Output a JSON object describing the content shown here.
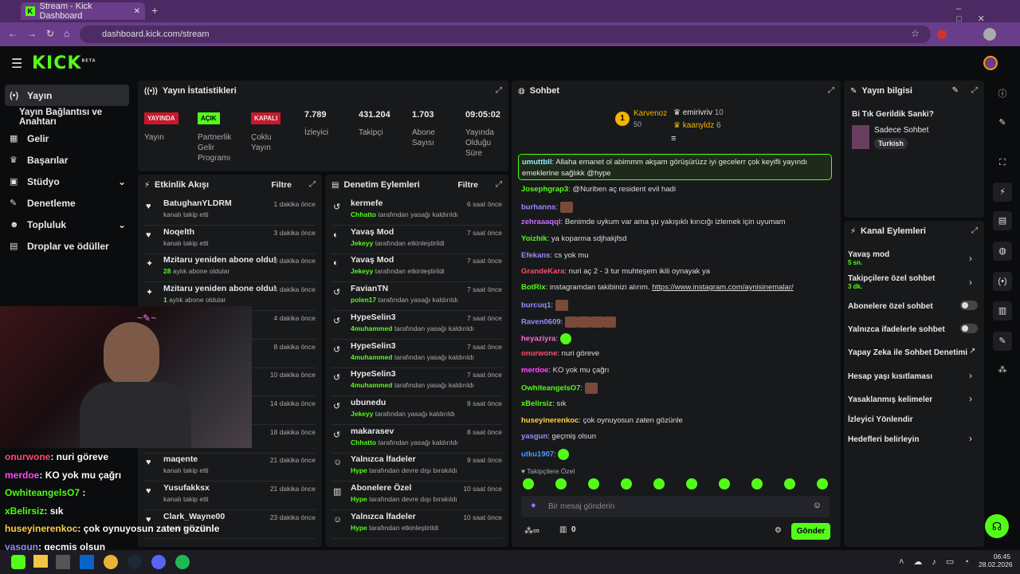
{
  "browser": {
    "tab_title": "Stream - Kick Dashboard",
    "url": "dashboard.kick.com/stream"
  },
  "header": {
    "logo": "KICK",
    "logo_beta": "BETA"
  },
  "sidebar": {
    "items": [
      {
        "label": "Yayın",
        "icon": "broadcast-icon"
      },
      {
        "label": "Yayın Bağlantısı ve Anahtarı",
        "icon": ""
      },
      {
        "label": "Gelir",
        "icon": "revenue-icon"
      },
      {
        "label": "Başarılar",
        "icon": "trophy-icon"
      },
      {
        "label": "Stüdyo",
        "icon": "studio-icon"
      },
      {
        "label": "Denetleme",
        "icon": "wrench-icon"
      },
      {
        "label": "Topluluk",
        "icon": "community-icon"
      },
      {
        "label": "Droplar ve ödüller",
        "icon": "gift-icon"
      }
    ]
  },
  "stats": {
    "title": "Yayın İstatistikleri",
    "live": {
      "badge": "YAYINDA",
      "label": "Yayın"
    },
    "partner": {
      "badge": "AÇIK",
      "label": "Partnerlik Gelir Programı"
    },
    "multi": {
      "badge": "KAPALI",
      "label": "Çoklu Yayın"
    },
    "viewers": {
      "value": "7.789",
      "label": "İzleyici"
    },
    "followers": {
      "value": "431.204",
      "label": "Takipçi"
    },
    "subs": {
      "value": "1.703",
      "label": "Abone Sayısı"
    },
    "uptime": {
      "value": "09:05:02",
      "label": "Yayında Olduğu Süre"
    }
  },
  "activity": {
    "title": "Etkinlik Akışı",
    "filter": "Filtre",
    "items": [
      {
        "name": "BatughanYLDRM",
        "sub": "kanalı takip etti",
        "time": "1 dakika önce"
      },
      {
        "name": "Noqelth",
        "sub": "kanalı takip etti",
        "time": "3 dakika önce"
      },
      {
        "name": "Mzitaru yeniden abone oldu!",
        "subb": "28",
        "sub": "aylık abone oldular",
        "time": "3 dakika önce"
      },
      {
        "name": "Mzitaru yeniden abone oldu!",
        "subb": "1",
        "sub": "aylık abone oldular",
        "time": "4 dakika önce"
      },
      {
        "time": "4 dakika önce"
      },
      {
        "time": "8 dakika önce"
      },
      {
        "time": "10 dakika önce"
      },
      {
        "time": "14 dakika önce"
      },
      {
        "time": "18 dakika önce"
      },
      {
        "name": "maqente",
        "sub": "kanalı takip etti",
        "time": "21 dakika önce"
      },
      {
        "name": "Yusufakksx",
        "sub": "kanalı takip etti",
        "time": "21 dakika önce"
      },
      {
        "name": "Clark_Wayne00",
        "sub": "kanalı takip etti",
        "time": "23 dakika önce"
      }
    ]
  },
  "moderation": {
    "title": "Denetim Eylemleri",
    "filter": "Filtre",
    "items": [
      {
        "name": "kermefe",
        "by": "Chhatto",
        "sub": "tarafından yasağı kaldırıldı",
        "time": "6 saat önce"
      },
      {
        "name": "Yavaş Mod",
        "by": "Jekeyy",
        "sub": "tarafından etkinleştirildi",
        "time": "7 saat önce"
      },
      {
        "name": "Yavaş Mod",
        "by": "Jekeyy",
        "sub": "tarafından etkinleştirildi",
        "time": "7 saat önce"
      },
      {
        "name": "FavianTN",
        "by": "polen17",
        "sub": "tarafından yasağı kaldırıldı",
        "time": "7 saat önce"
      },
      {
        "name": "HypeSelin3",
        "by": "4muhammed",
        "sub": "tarafından yasağı kaldırıldı",
        "time": "7 saat önce"
      },
      {
        "name": "HypeSelin3",
        "by": "4muhammed",
        "sub": "tarafından yasağı kaldırıldı",
        "time": "7 saat önce"
      },
      {
        "name": "HypeSelin3",
        "by": "4muhammed",
        "sub": "tarafından yasağı kaldırıldı",
        "time": "7 saat önce"
      },
      {
        "name": "ubunedu",
        "by": "Jekeyy",
        "sub": "tarafından yasağı kaldırıldı",
        "time": "8 saat önce"
      },
      {
        "name": "makarasev",
        "by": "Chhatto",
        "sub": "tarafından yasağı kaldırıldı",
        "time": "8 saat önce"
      },
      {
        "name": "Yalnızca İfadeler",
        "by": "Hype",
        "sub": "tarafından devre dışı bırakıldı",
        "time": "9 saat önce"
      },
      {
        "name": "Abonelere Özel",
        "by": "Hype",
        "sub": "tarafından devre dışı bırakıldı",
        "time": "10 saat önce"
      },
      {
        "name": "Yalnızca İfadeler",
        "by": "Hype",
        "sub": "tarafından etkinleştirildi",
        "time": "10 saat önce"
      }
    ]
  },
  "chat": {
    "title": "Sohbet",
    "top": [
      {
        "rank": "1",
        "name": "Karvenoz",
        "pts": "50"
      },
      {
        "name": "emirivriv",
        "pts": "10"
      },
      {
        "name": "kaanyldz",
        "pts": "6"
      }
    ],
    "pinned": {
      "user": "umuttbll",
      "text": "Allaha emanet ol abimmm akşam görüşürüzz iyi gecelerr çok keyifli yayındı emeklerine sağlıkk @hype"
    },
    "messages": [
      {
        "user": "Josephgrap3",
        "color": "#53fc18",
        "text": "@Nuriben aç resident evil hadi"
      },
      {
        "user": "burhanns",
        "color": "#9b8cff",
        "text": ""
      },
      {
        "user": "zehraaaqql",
        "color": "#c86bff",
        "text": "Benimde uykum var ama şu yakışıklı kırıcığı izlemek için uyumam"
      },
      {
        "user": "Yoizhik",
        "color": "#53fc18",
        "text": "ya koparma sdjhakjfsd"
      },
      {
        "user": "Efekans",
        "color": "#9b8cff",
        "text": "cs yok mu"
      },
      {
        "user": "GrandeKara",
        "color": "#ff4b6e",
        "text": "nuri aç 2 - 3 tur muhteşem ikili oynayak ya"
      },
      {
        "user": "BotRix",
        "color": "#53fc18",
        "text": "instagramdan takibinizi alırım.",
        "link": "https://www.instagram.com/aynisinemalar/"
      },
      {
        "user": "burcuq1",
        "color": "#9b8cff",
        "text": ""
      },
      {
        "user": "Raven0609",
        "color": "#9b8cff",
        "text": ""
      },
      {
        "user": "heyaziyra",
        "color": "#ff6bd6",
        "text": ""
      },
      {
        "user": "onurwone",
        "color": "#ff4b6e",
        "text": "nuri göreve"
      },
      {
        "user": "merdoe",
        "color": "#ff4bff",
        "text": "KO yok mu çağrı"
      },
      {
        "user": "OwhiteangelsO7",
        "color": "#53fc18",
        "text": ""
      },
      {
        "user": "xBelirsiz",
        "color": "#53fc18",
        "text": "sık"
      },
      {
        "user": "huseyinerenkoc",
        "color": "#ffcf4b",
        "text": "çok oynuyosun zaten gözünle"
      },
      {
        "user": "yasgun",
        "color": "#9b8cff",
        "text": "geçmiş olsun"
      },
      {
        "user": "utku1907",
        "color": "#4b9bff",
        "text": ""
      }
    ],
    "followers_label": "Takipçilere Özel",
    "placeholder": "Bir mesaj gönderin",
    "count": "0",
    "send": "Gönder"
  },
  "info": {
    "title": "Yayın bilgisi",
    "stream_title": "Bi Tık Gerildik Sanki?",
    "category": "Sadece Sohbet",
    "tag": "Turkish"
  },
  "actions": {
    "title": "Kanal Eylemleri",
    "items": [
      {
        "label": "Yavaş mod",
        "sub": "5 sn."
      },
      {
        "label": "Takipçilere özel sohbet",
        "sub": "3 dk."
      },
      {
        "label": "Abonelere özel sohbet"
      },
      {
        "label": "Yalnızca ifadelerle sohbet"
      },
      {
        "label": "Yapay Zeka ile Sohbet Denetimi"
      },
      {
        "label": "Hesap yaşı kısıtlaması"
      },
      {
        "label": "Yasaklanmış kelimeler"
      },
      {
        "label": "İzleyici Yönlendir"
      },
      {
        "label": "Hedefleri belirleyin"
      }
    ]
  },
  "overlay_chat": [
    {
      "user": "onurwone",
      "text": ": nuri göreve",
      "color": "#ff4b6e"
    },
    {
      "user": "merdoe",
      "text": ": KO yok mu çağrı",
      "color": "#ff4bff"
    },
    {
      "user": "OwhiteangelsO7",
      "text": " :",
      "color": "#53fc18"
    },
    {
      "user": "xBelirsiz",
      "text": ": sık",
      "color": "#53fc18"
    },
    {
      "user": "huseyinerenkoc",
      "text": ": çok oynuyosun zaten gözünle",
      "color": "#ffcf4b"
    },
    {
      "user": "yasgun",
      "text": ": geçmiş olsun",
      "color": "#9b8cff"
    }
  ],
  "taskbar": {
    "time": "06:45",
    "date": "28.02.2026"
  }
}
